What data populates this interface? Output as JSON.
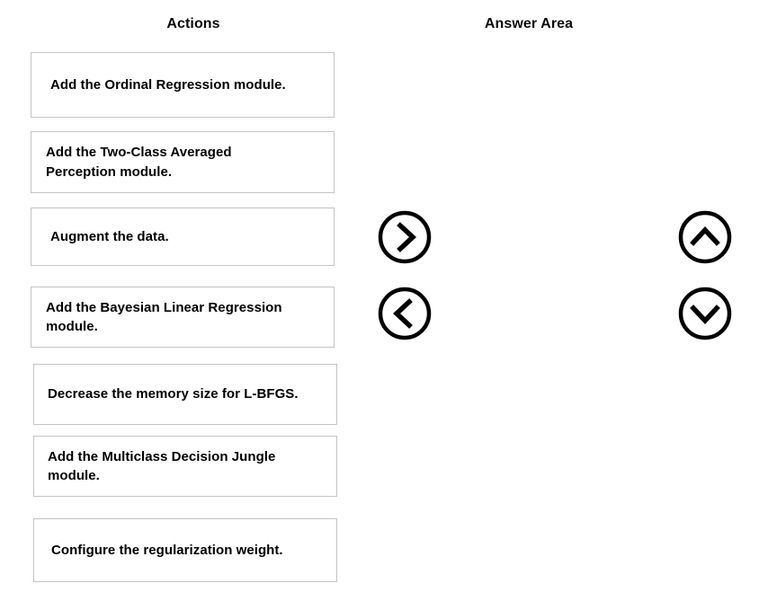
{
  "columns": {
    "actions_header": "Actions",
    "answer_header": "Answer Area"
  },
  "actions": {
    "items": [
      {
        "label": "Add the Ordinal Regression module."
      },
      {
        "label": "Add the Two-Class Averaged\nPerception module."
      },
      {
        "label": "Augment the data."
      },
      {
        "label": "Add the Bayesian Linear Regression\n module."
      },
      {
        "label": "Decrease the memory size for L-BFGS."
      },
      {
        "label": "Add the Multiclass Decision Jungle\nmodule."
      },
      {
        "label": "Configure the regularization weight."
      }
    ]
  },
  "answer_area": {
    "items": []
  },
  "controls": {
    "move_right": {
      "icon": "chevron-right-circle-icon",
      "title": "Move right"
    },
    "move_left": {
      "icon": "chevron-left-circle-icon",
      "title": "Move left"
    },
    "move_up": {
      "icon": "chevron-up-circle-icon",
      "title": "Move up"
    },
    "move_down": {
      "icon": "chevron-down-circle-icon",
      "title": "Move down"
    }
  },
  "colors": {
    "background": "#ffffff",
    "card_border": "#c4c4c4",
    "text": "#000000",
    "icon_stroke": "#000000"
  }
}
